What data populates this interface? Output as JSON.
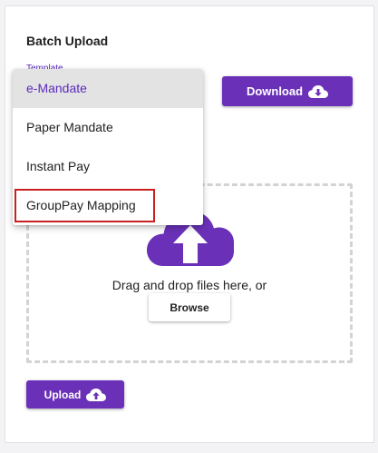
{
  "card": {
    "title": "Batch Upload",
    "template_label": "Template"
  },
  "download_button": {
    "label": "Download",
    "icon": "cloud-download-icon"
  },
  "dropzone": {
    "icon": "cloud-upload-icon",
    "text": "Drag and drop files here, or",
    "browse_label": "Browse"
  },
  "upload_button": {
    "label": "Upload",
    "icon": "cloud-upload-icon"
  },
  "template_menu": {
    "items": [
      {
        "label": "e-Mandate",
        "selected": true
      },
      {
        "label": "Paper Mandate",
        "selected": false
      },
      {
        "label": "Instant Pay",
        "selected": false
      },
      {
        "label": "GroupPay Mapping",
        "selected": false,
        "highlighted": true
      }
    ]
  },
  "colors": {
    "accent": "#6a31b8",
    "selected_text": "#5b2bbd",
    "highlight_border": "#c82020",
    "dropzone_border": "#d3d3d3"
  }
}
